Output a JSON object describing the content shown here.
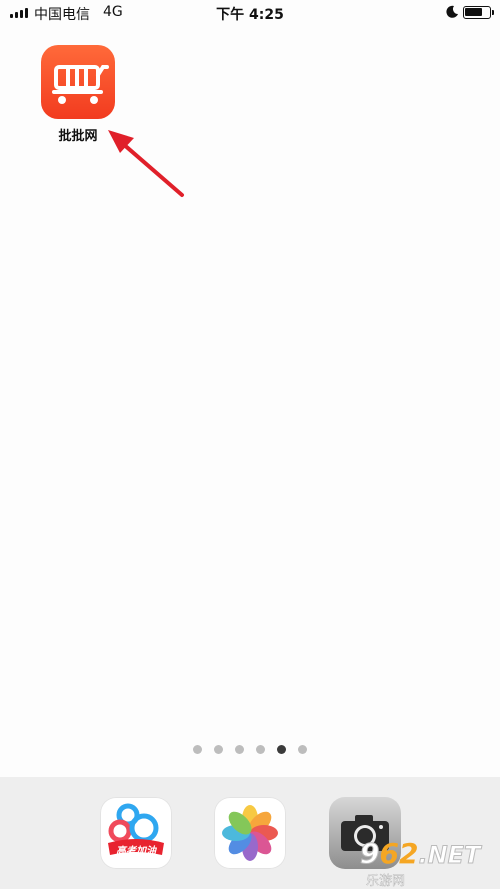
{
  "status_bar": {
    "carrier": "中国电信",
    "network": "4G",
    "time": "下午 4:25",
    "icons": [
      "signal-icon",
      "moon-icon",
      "battery-icon"
    ]
  },
  "home_screen": {
    "apps": [
      {
        "label": "批批网",
        "icon": "shopping-cart-icon",
        "color": "#f5441f"
      }
    ],
    "page_count": 6,
    "active_page": 5
  },
  "dock": {
    "apps": [
      {
        "icon": "gaokao-cloud-icon",
        "badge_text": "高考加油"
      },
      {
        "icon": "photos-flower-icon"
      },
      {
        "icon": "camera-icon"
      }
    ]
  },
  "annotation": {
    "icon": "red-arrow-icon",
    "color": "#e0202a"
  },
  "watermark": {
    "text_prefix": "9",
    "text_main": "62",
    "text_suffix": ".NET",
    "subtitle": "乐游网"
  }
}
